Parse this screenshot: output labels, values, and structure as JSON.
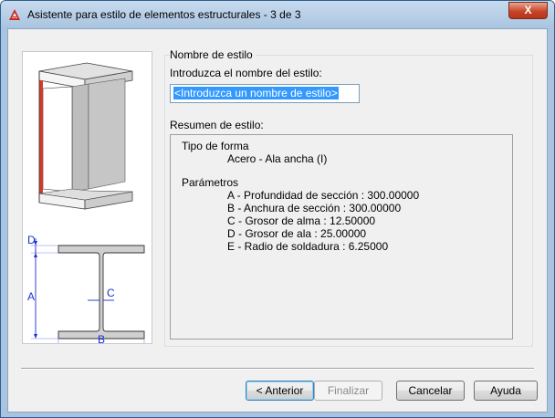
{
  "window": {
    "title": "Asistente para estilo de elementos estructurales - 3 de 3",
    "close_glyph": "X"
  },
  "illustration": {
    "labels": {
      "d": "D",
      "a": "A",
      "c": "C",
      "b": "B"
    }
  },
  "style_name": {
    "section_label": "Nombre de estilo",
    "field_label": "Introduzca el nombre del estilo:",
    "input_value": "<Introduzca un nombre de estilo>"
  },
  "summary": {
    "label": "Resumen de estilo:",
    "shape_heading": "Tipo de forma",
    "shape_value": "Acero - Ala ancha (I)",
    "params_heading": "Parámetros",
    "params": [
      "A - Profundidad de sección : 300.00000",
      "B - Anchura de sección : 300.00000",
      "C - Grosor de alma : 12.50000",
      "D - Grosor de ala : 25.00000",
      "E - Radio de soldadura : 6.25000"
    ]
  },
  "buttons": {
    "back": "< Anterior",
    "finish": "Finalizar",
    "cancel": "Cancelar",
    "help": "Ayuda"
  },
  "colors": {
    "accent_red": "#d23a2a",
    "selection": "#3399ff"
  }
}
